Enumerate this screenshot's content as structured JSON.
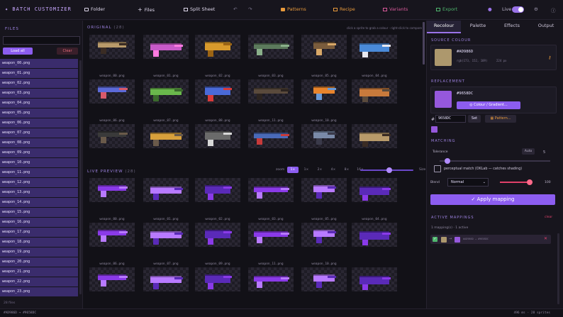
{
  "app": {
    "title": "✦ BATCH CUSTOMIZER"
  },
  "toolbar": {
    "folder": "Folder",
    "files": "Files",
    "split_sheet": "Split Sheet",
    "patterns": "Patterns",
    "recipe": "Recipe",
    "variants": "Variants",
    "export": "Export",
    "live": "Live",
    "live_on": true
  },
  "files": {
    "title": "FILES",
    "load_all": "Load all",
    "clear": "Clear",
    "items": [
      "weapon_00.png",
      "weapon_01.png",
      "weapon_02.png",
      "weapon_03.png",
      "weapon_04.png",
      "weapon_05.png",
      "weapon_06.png",
      "weapon_07.png",
      "weapon_08.png",
      "weapon_09.png",
      "weapon_10.png",
      "weapon_11.png",
      "weapon_12.png",
      "weapon_13.png",
      "weapon_14.png",
      "weapon_15.png",
      "weapon_16.png",
      "weapon_17.png",
      "weapon_18.png",
      "weapon_19.png",
      "weapon_20.png",
      "weapon_21.png",
      "weapon_22.png",
      "weapon_23.png"
    ],
    "count": "28 files"
  },
  "original": {
    "title": "ORIGINAL",
    "count": "(28)",
    "hint": "click a sprite to grab a colour · right-click to compare",
    "captions": [
      "weapon_00.png",
      "weapon_01.png",
      "weapon_02.png",
      "weapon_03.png",
      "weapon_05.png",
      "weapon_04.png",
      "weapon_06.png",
      "weapon_07.png",
      "weapon_08.png",
      "weapon_11.png",
      "weapon_10.png"
    ]
  },
  "live_preview": {
    "title": "LIVE PREVIEW",
    "count": "(28)",
    "zoom_label": "zoom",
    "zoom_options": [
      "1×",
      "1×",
      "2×",
      "4×",
      "8×",
      "16×"
    ],
    "zoom_selected": 0,
    "size_label": "Size",
    "captions": [
      "weapon_00.png",
      "weapon_01.png",
      "weapon_02.png",
      "weapon_03.png",
      "weapon_05.png",
      "weapon_04.png",
      "weapon_06.png",
      "weapon_07.png",
      "weapon_09.png",
      "weapon_11.png",
      "weapon_10.png"
    ]
  },
  "panel": {
    "tabs": [
      "Recolour",
      "Palette",
      "Effects",
      "Output"
    ],
    "active_tab": 0,
    "source_title": "SOURCE COLOUR",
    "source_hex": "#AD986D",
    "source_rgb": "rgb(173, 152, 109)",
    "source_px": "224 px",
    "source_color": "#ad986d",
    "replacement_title": "REPLACEMENT",
    "replacement_hex": "#9658DC",
    "replacement_color": "#9658dc",
    "colour_btn": "Colour / Gradient...",
    "hex_prefix": "#",
    "hex_value": "9658DC",
    "set_btn": "Set",
    "pattern_btn": "Pattern...",
    "matching_title": "MATCHING",
    "tolerance_label": "Tolerance",
    "auto_label": "Auto",
    "tolerance_value": "5",
    "tolerance_fraction": 0.05,
    "perceptual_label": "perceptual match (OKLab — catches shading)",
    "blend_label": "Blend",
    "blend_value": "Normal",
    "blend_pct": "100",
    "apply_label": "✓ Apply mapping",
    "active_title": "ACTIVE MAPPINGS",
    "clear_label": "clear",
    "mappings_count": "1 mapping(s) · 1 active",
    "mapping_text": "#AD986D → #9658DC"
  },
  "status": {
    "left": "#AD986D → #9658DC",
    "right": "496 ms · 28 sprites"
  },
  "colors": {
    "accent": "#9a73e8",
    "file_bg": "#3a2c6c",
    "orange": "#e89a3c",
    "pink": "#d85a9b",
    "green": "#4fb66e"
  }
}
